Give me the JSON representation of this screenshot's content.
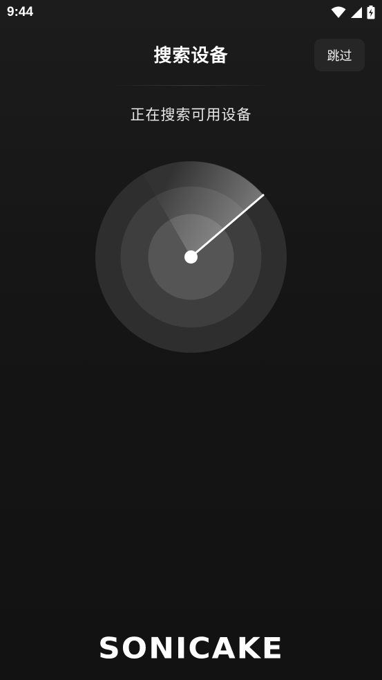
{
  "status_bar": {
    "time": "9:44",
    "icons": [
      "wifi-icon",
      "cellular-signal-icon",
      "battery-charging-icon"
    ]
  },
  "header": {
    "title": "搜索设备",
    "skip_label": "跳过"
  },
  "main": {
    "subtitle": "正在搜索可用设备",
    "radar": {
      "state": "scanning",
      "ring_count": 3
    }
  },
  "footer": {
    "brand": "SONICAKE"
  },
  "colors": {
    "background": "#141414",
    "ring_outer": "#2e2e2e",
    "ring_middle": "#3e3e3e",
    "ring_inner": "#555555",
    "accent": "#ffffff",
    "skip_bg": "#262626"
  }
}
